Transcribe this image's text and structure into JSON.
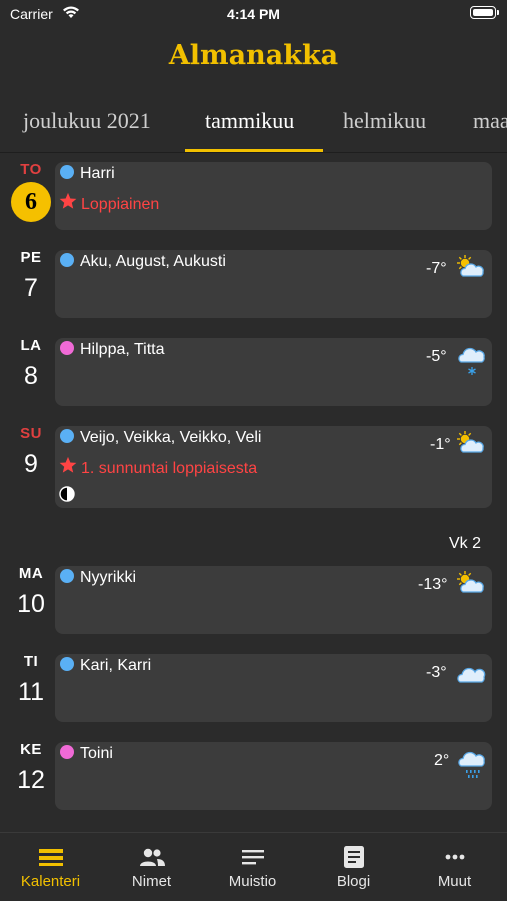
{
  "status_bar": {
    "carrier": "Carrier",
    "time": "4:14 PM"
  },
  "app_title": "Almanakka",
  "months": [
    {
      "label": "joulukuu 2021",
      "active": false
    },
    {
      "label": "tammikuu",
      "active": true
    },
    {
      "label": "helmikuu",
      "active": false
    },
    {
      "label": "maa",
      "active": false
    }
  ],
  "days": [
    {
      "dow": "TO",
      "num": "6",
      "names": "Harri",
      "dot": "blue",
      "holiday": "Loppiainen",
      "today": true,
      "dow_color": "red"
    },
    {
      "dow": "PE",
      "num": "7",
      "names": "Aku, August, Aukusti",
      "dot": "blue",
      "temp": "-7°",
      "weather": "sun-cloud"
    },
    {
      "dow": "LA",
      "num": "8",
      "names": "Hilppa, Titta",
      "dot": "pink",
      "temp": "-5°",
      "weather": "snow"
    },
    {
      "dow": "SU",
      "num": "9",
      "names": "Veijo, Veikka, Veikko, Veli",
      "dot": "blue",
      "holiday": "1. sunnuntai loppiaisesta",
      "temp": "-1°",
      "weather": "sun-cloud",
      "moon": "half-moon",
      "dow_color": "red"
    },
    {
      "dow": "MA",
      "num": "10",
      "names": "Nyyrikki",
      "dot": "blue",
      "temp": "-13°",
      "weather": "sun-cloud"
    },
    {
      "dow": "TI",
      "num": "11",
      "names": "Kari, Karri",
      "dot": "blue",
      "temp": "-3°",
      "weather": "cloud"
    },
    {
      "dow": "KE",
      "num": "12",
      "names": "Toini",
      "dot": "pink",
      "temp": "2°",
      "weather": "rain"
    }
  ],
  "week_label": "Vk 2",
  "tabs": [
    {
      "label": "Kalenteri",
      "icon": "calendar-icon",
      "active": true
    },
    {
      "label": "Nimet",
      "icon": "people-icon"
    },
    {
      "label": "Muistio",
      "icon": "lines-icon"
    },
    {
      "label": "Blogi",
      "icon": "document-icon"
    },
    {
      "label": "Muut",
      "icon": "more-icon"
    }
  ],
  "colors": {
    "accent": "#f2c000",
    "holiday": "#ff4444",
    "name_dot_blue": "#5ab0f5",
    "name_dot_pink": "#f06ad6"
  }
}
